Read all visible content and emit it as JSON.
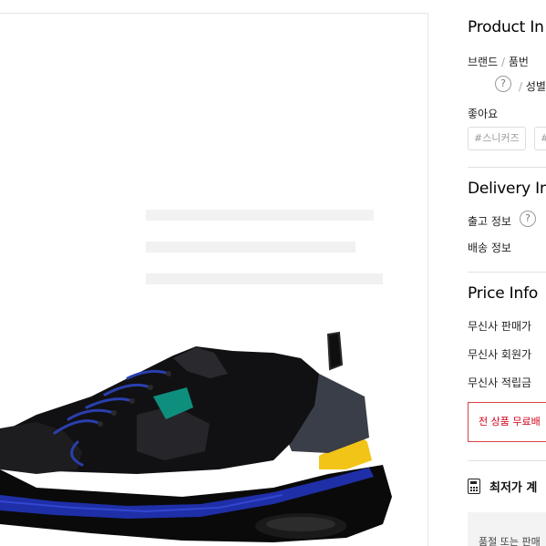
{
  "product_info": {
    "title": "Product In",
    "brand_label": "브랜드",
    "separator": "/",
    "product_no_label": "품번",
    "gender_label": "성별",
    "likes_label": "좋아요",
    "tags": [
      "#스니커즈",
      "#"
    ]
  },
  "delivery_info": {
    "title": "Delivery In",
    "shipping_label": "출고 정보",
    "delivery_label": "배송 정보"
  },
  "price_info": {
    "title": "Price Info",
    "sale_price_label": "무신사 판매가",
    "member_price_label": "무신사 회원가",
    "points_label": "무신사 적립금",
    "free_shipping_banner": "전 상품 무료배",
    "lowest_price_label": "최저가 계",
    "notice_text": "품절 또는 판매"
  },
  "icons": {
    "help": "question-circle-icon",
    "calculator": "calculator-icon"
  },
  "colors": {
    "accent_red": "#d0021b",
    "sneaker_blue": "#1f2fa8",
    "sneaker_yellow": "#f2c418",
    "sneaker_teal": "#0e8f7e"
  }
}
